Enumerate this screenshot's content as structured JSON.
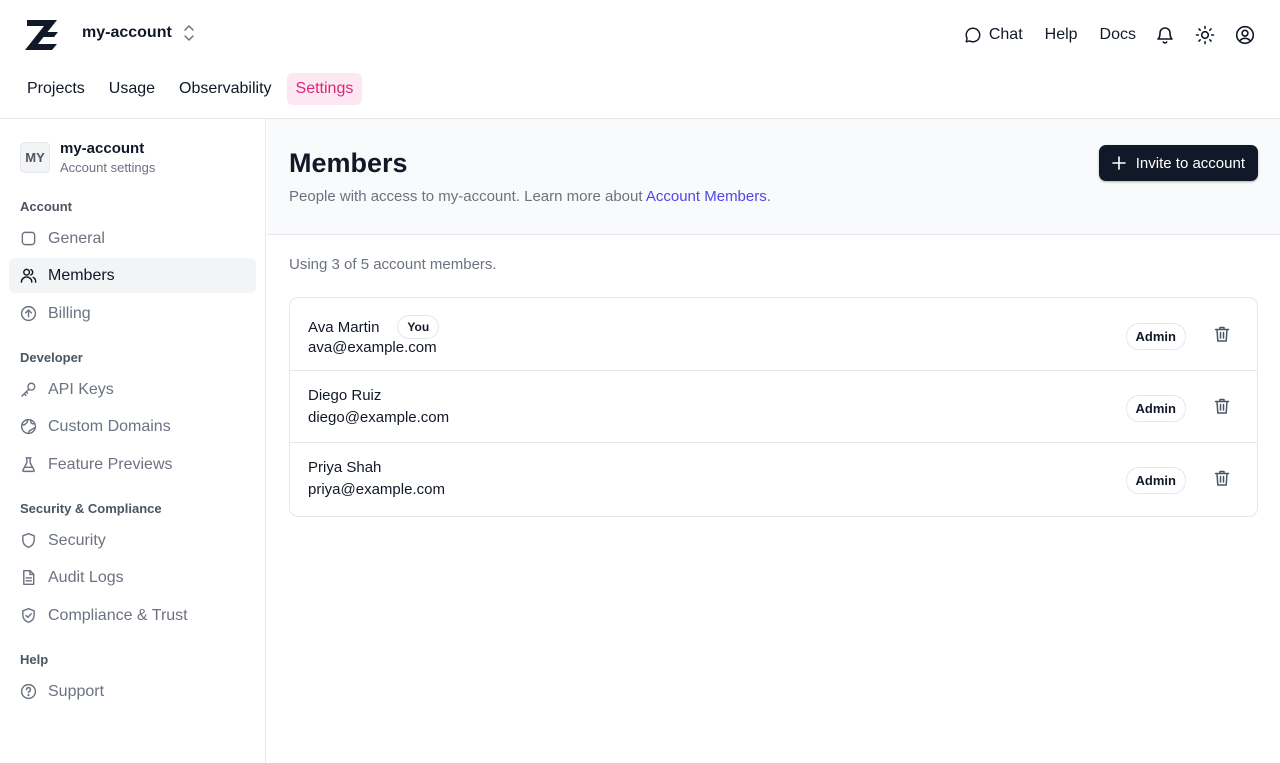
{
  "header": {
    "account_name": "my-account",
    "links": {
      "chat": "Chat",
      "help": "Help",
      "docs": "Docs"
    },
    "tabs": [
      {
        "label": "Projects"
      },
      {
        "label": "Usage"
      },
      {
        "label": "Observability"
      },
      {
        "label": "Settings",
        "active": true
      }
    ]
  },
  "sidebar": {
    "avatar_initials": "MY",
    "account_name": "my-account",
    "account_sub": "Account settings",
    "sections": {
      "account": "Account",
      "developer": "Developer",
      "security": "Security & Compliance",
      "help": "Help"
    },
    "items": {
      "general": "General",
      "members": "Members",
      "billing": "Billing",
      "api_keys": "API Keys",
      "custom_domains": "Custom Domains",
      "feature_previews": "Feature Previews",
      "security": "Security",
      "audit_logs": "Audit Logs",
      "compliance": "Compliance & Trust",
      "support": "Support"
    }
  },
  "main": {
    "title": "Members",
    "desc_prefix": "People with access to my-account. Learn more about ",
    "desc_link": "Account Members",
    "desc_suffix": ".",
    "invite_label": "Invite to account",
    "usage_text": "Using 3 of 5 account members.",
    "members": [
      {
        "name": "Ava Martin",
        "you": "You",
        "email": "ava@example.com",
        "role": "Admin"
      },
      {
        "name": "Diego Ruiz",
        "email": "diego@example.com",
        "role": "Admin"
      },
      {
        "name": "Priya Shah",
        "email": "priya@example.com",
        "role": "Admin"
      }
    ]
  },
  "colors": {
    "accent_pink": "#db2777",
    "accent_pink_bg": "#fce7f3",
    "link": "#4f46e5",
    "primary_button": "#111827"
  }
}
